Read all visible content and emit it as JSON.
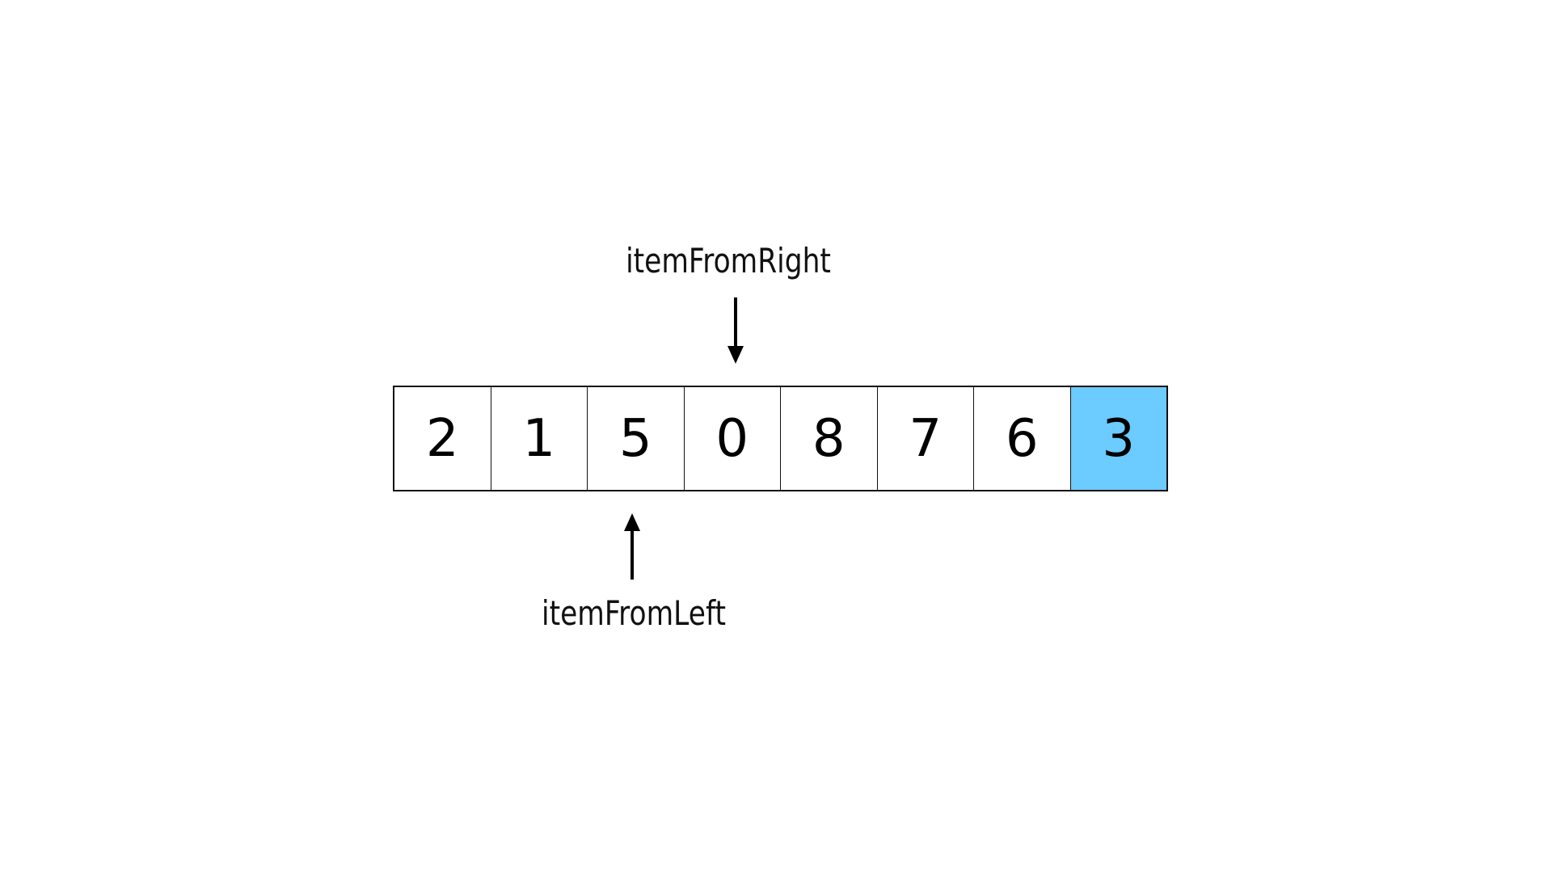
{
  "array": {
    "values": [
      "2",
      "1",
      "5",
      "0",
      "8",
      "7",
      "6",
      "3"
    ],
    "highlight_index": 7,
    "highlight_color": "#6ccbff"
  },
  "pointers": {
    "right": {
      "label": "itemFromRight",
      "index": 3,
      "direction": "down"
    },
    "left": {
      "label": "itemFromLeft",
      "index": 2,
      "direction": "up"
    }
  }
}
